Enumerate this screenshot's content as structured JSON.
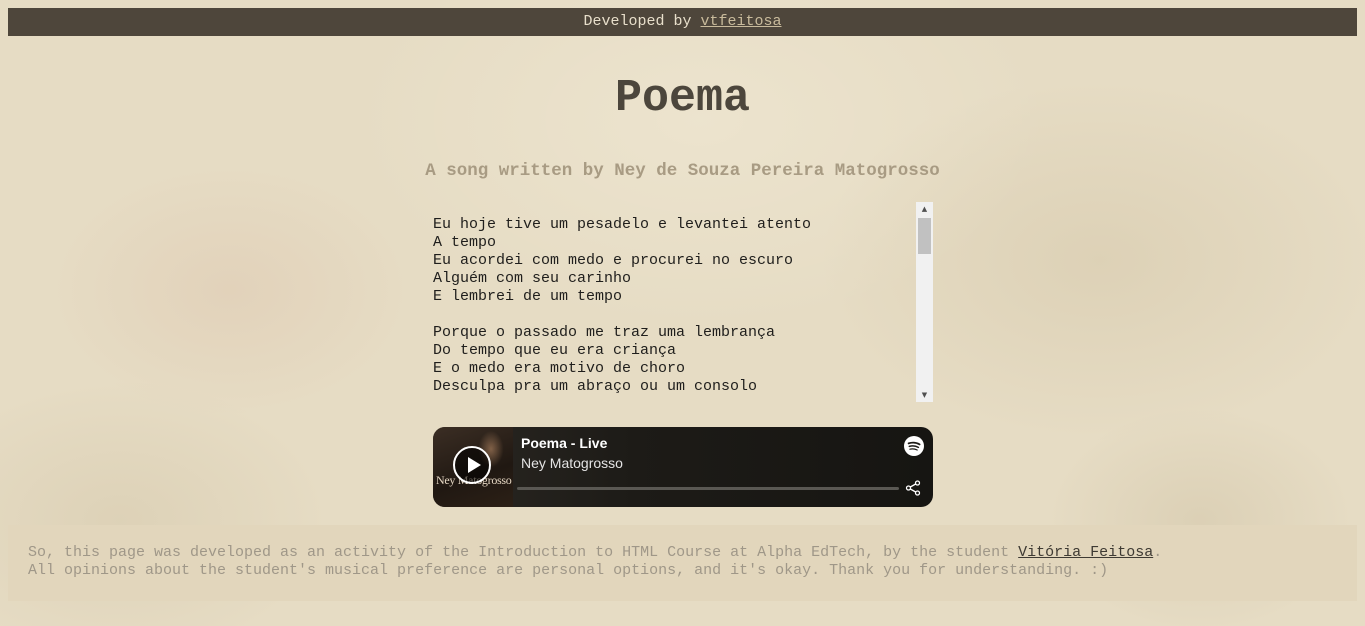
{
  "topbar": {
    "prefix": "Developed by ",
    "author_link": "vtfeitosa"
  },
  "page": {
    "title": "Poema",
    "subtitle": "A song written by Ney de Souza Pereira Matogrosso"
  },
  "lyrics": {
    "lines": [
      "Eu hoje tive um pesadelo e levantei atento",
      "A tempo",
      "Eu acordei com medo e procurei no escuro",
      "Alguém com seu carinho",
      "E lembrei de um tempo",
      "",
      "Porque o passado me traz uma lembrança",
      "Do tempo que eu era criança",
      "E o medo era motivo de choro",
      "Desculpa pra um abraço ou um consolo"
    ],
    "scroll_up_icon": "triangle-up-icon",
    "scroll_down_icon": "triangle-down-icon"
  },
  "player": {
    "track_title": "Poema - Live",
    "artist": "Ney Matogrosso",
    "cover_text": "Ney Matogrosso",
    "progress_fraction": 0,
    "play_icon": "play-icon",
    "brand_icon": "spotify-logo-icon",
    "share_icon": "share-icon",
    "colors": {
      "background": "#1d1b17",
      "track": "#5a5853",
      "text": "#ffffff"
    }
  },
  "footer": {
    "line1_prefix": "So, this page was developed as an activity of the Introduction to HTML Course at Alpha EdTech, by the student ",
    "line1_link": "Vitória Feitosa",
    "line1_suffix": ".",
    "line2": "All opinions about the student's musical preference are personal options, and it's okay. Thank you for understanding. :)"
  },
  "colors": {
    "topbar_bg": "#4e463b",
    "title": "#4c463c",
    "subtitle": "#a89b83",
    "footer_bg": "#e2d6bc",
    "footer_text": "#9f9788"
  }
}
